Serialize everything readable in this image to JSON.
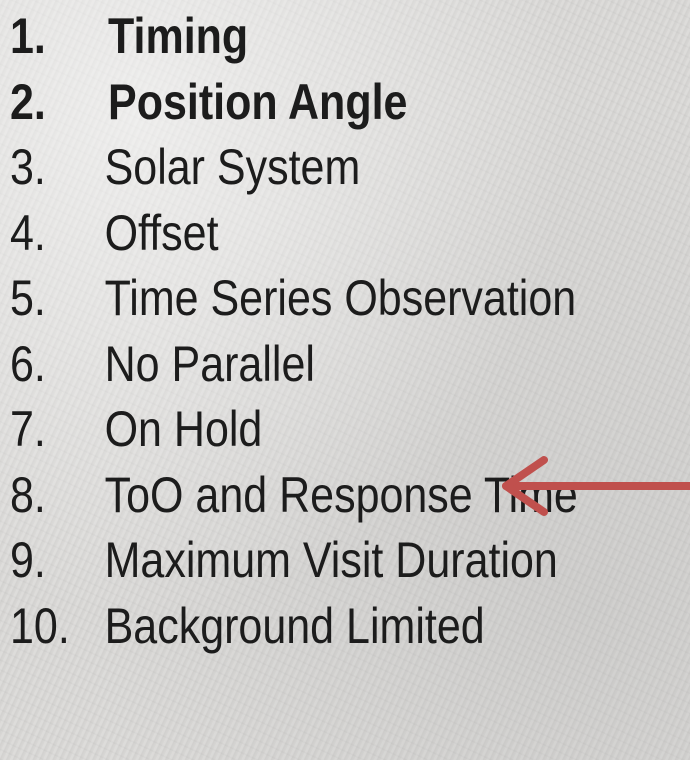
{
  "items": [
    {
      "number": "1.",
      "label": "Timing",
      "bold": true
    },
    {
      "number": "2.",
      "label": "Position Angle",
      "bold": true
    },
    {
      "number": "3.",
      "label": "Solar System",
      "bold": false
    },
    {
      "number": "4.",
      "label": "Offset",
      "bold": false
    },
    {
      "number": "5.",
      "label": "Time Series Observation",
      "bold": false
    },
    {
      "number": "6.",
      "label": "No Parallel",
      "bold": false
    },
    {
      "number": "7.",
      "label": "On Hold",
      "bold": false
    },
    {
      "number": "8.",
      "label": "ToO and Response Time",
      "bold": false
    },
    {
      "number": "9.",
      "label": "Maximum Visit Duration",
      "bold": false
    },
    {
      "number": "10.",
      "label": "Background Limited",
      "bold": false
    }
  ],
  "arrow": {
    "color": "#c0504d",
    "points_to_item": "7"
  }
}
